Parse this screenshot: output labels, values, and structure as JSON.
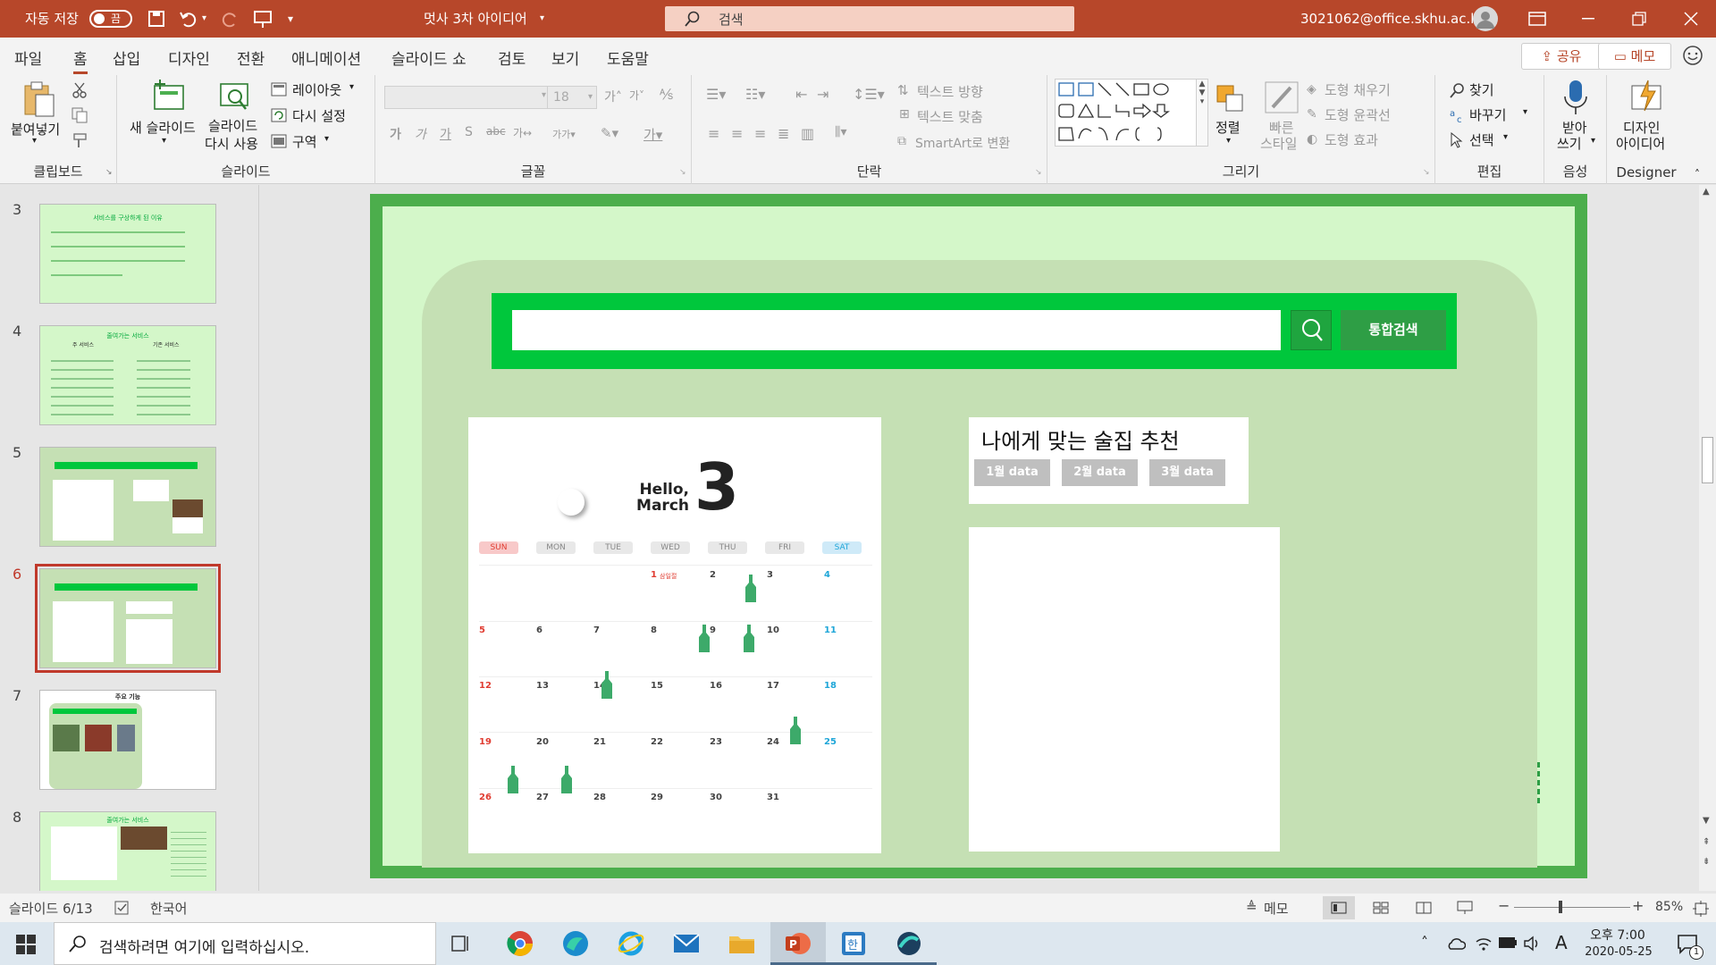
{
  "titlebar": {
    "autosave_label": "자동 저장",
    "autosave_state": "끔",
    "doc_title": "멋사 3차 아이디어",
    "search_placeholder": "검색",
    "account": "3021062@office.skhu.ac.kr"
  },
  "menu": {
    "tabs": [
      "파일",
      "홈",
      "삽입",
      "디자인",
      "전환",
      "애니메이션",
      "슬라이드 쇼",
      "검토",
      "보기",
      "도움말"
    ],
    "share": "공유",
    "comment": "메모"
  },
  "ribbon": {
    "clipboard": {
      "paste": "붙여넣기",
      "label": "클립보드"
    },
    "slides": {
      "new_slide_1": "새 슬라이드",
      "reuse_1": "슬라이드",
      "reuse_2": "다시 사용",
      "layout": "레이아웃",
      "reset": "다시 설정",
      "section": "구역",
      "label": "슬라이드"
    },
    "font": {
      "size": "18",
      "label": "글꼴"
    },
    "paragraph": {
      "text_direction": "텍스트 방향",
      "align_text": "텍스트 맞춤",
      "smartart": "SmartArt로 변환",
      "label": "단락"
    },
    "drawing": {
      "arrange": "정렬",
      "quick_1": "빠른",
      "quick_2": "스타일",
      "fill": "도형 채우기",
      "outline": "도형 윤곽선",
      "effects": "도형 효과",
      "label": "그리기"
    },
    "editing": {
      "find": "찾기",
      "replace": "바꾸기",
      "select": "선택",
      "label": "편집"
    },
    "voice": {
      "dictate_1": "받아",
      "dictate_2": "쓰기",
      "label": "음성"
    },
    "designer": {
      "ideas_1": "디자인",
      "ideas_2": "아이디어",
      "label": "Designer"
    }
  },
  "thumbnails": {
    "numbers": [
      "3",
      "4",
      "5",
      "6",
      "7",
      "8"
    ],
    "t3_title": "서비스를 구상하게 된 이유",
    "t4_title": "줄여가는 서비스",
    "t4_left": "주 서비스",
    "t4_right": "기존 서비스",
    "t7_title": "주요 기능",
    "t8_title": "줄여가는 서비스"
  },
  "slide": {
    "search_button": "통합검색",
    "calendar": {
      "hello": "Hello,",
      "march": "March",
      "big_number": "3",
      "days": [
        "SUN",
        "MON",
        "TUE",
        "WED",
        "THU",
        "FRI",
        "SAT"
      ],
      "rows": [
        [
          "",
          "",
          "",
          "1",
          "2",
          "3",
          "4"
        ],
        [
          "5",
          "6",
          "7",
          "8",
          "9",
          "10",
          "11"
        ],
        [
          "12",
          "13",
          "14",
          "15",
          "16",
          "17",
          "18"
        ],
        [
          "19",
          "20",
          "21",
          "22",
          "23",
          "24",
          "25"
        ],
        [
          "26",
          "27",
          "28",
          "29",
          "30",
          "31",
          ""
        ]
      ],
      "holiday_note": "삼일절"
    },
    "recommend": {
      "title": "나에게 맞는 술집 추천",
      "buttons": [
        "1월  data",
        "2월 data",
        "3월 data"
      ]
    }
  },
  "status": {
    "slide_counter": "슬라이드 6/13",
    "language": "한국어",
    "notes": "메모",
    "zoom": "85%"
  },
  "taskbar": {
    "search_placeholder": "검색하려면 여기에 입력하십시오.",
    "time": "오후 7:00",
    "date": "2020-05-25",
    "ime": "A",
    "notification_count": "1"
  }
}
